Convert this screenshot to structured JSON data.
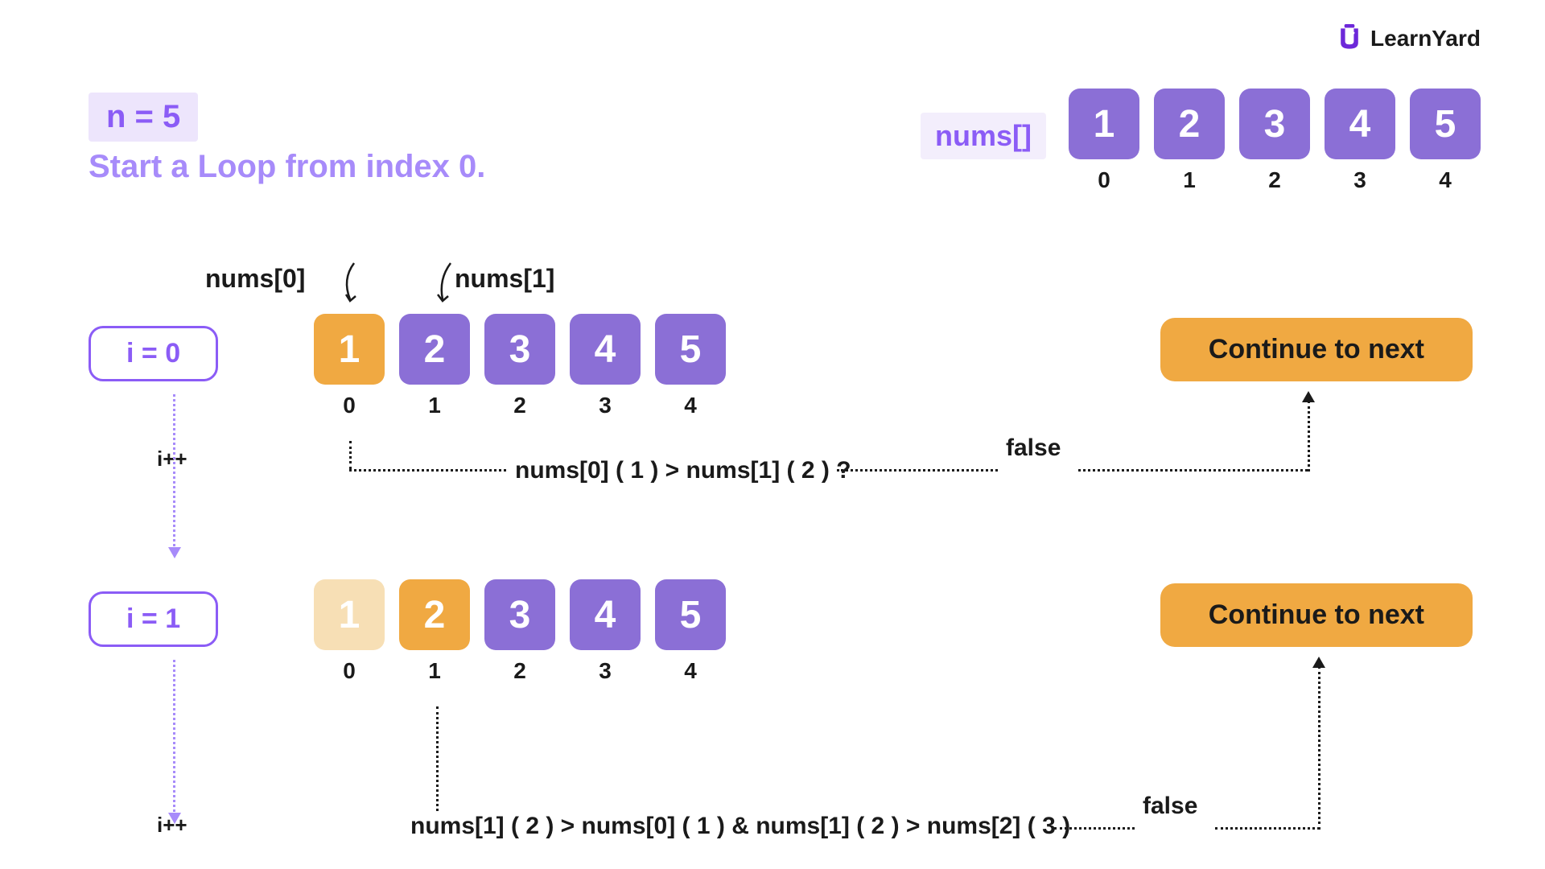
{
  "brand": {
    "name": "LearnYard"
  },
  "header": {
    "n_label": "n = 5",
    "subtitle": "Start a Loop from index 0.",
    "nums_label": "nums[]"
  },
  "top_array": {
    "values": [
      "1",
      "2",
      "3",
      "4",
      "5"
    ],
    "indices": [
      "0",
      "1",
      "2",
      "3",
      "4"
    ]
  },
  "iteration1": {
    "i_label": "i = 0",
    "pointer0": "nums[0]",
    "pointer1": "nums[1]",
    "values": [
      "1",
      "2",
      "3",
      "4",
      "5"
    ],
    "indices": [
      "0",
      "1",
      "2",
      "3",
      "4"
    ],
    "highlight_index": 0,
    "condition": "nums[0] ( 1 ) > nums[1] ( 2 ) ?",
    "result": "false",
    "continue": "Continue to next",
    "increment": "i++"
  },
  "iteration2": {
    "i_label": "i = 1",
    "values": [
      "1",
      "2",
      "3",
      "4",
      "5"
    ],
    "indices": [
      "0",
      "1",
      "2",
      "3",
      "4"
    ],
    "highlight_index": 1,
    "fade_index": 0,
    "condition": "nums[1] ( 2 ) > nums[0] ( 1 ) & nums[1] ( 2 ) > nums[2] ( 3 )",
    "result": "false",
    "continue": "Continue to next",
    "increment": "i++"
  }
}
